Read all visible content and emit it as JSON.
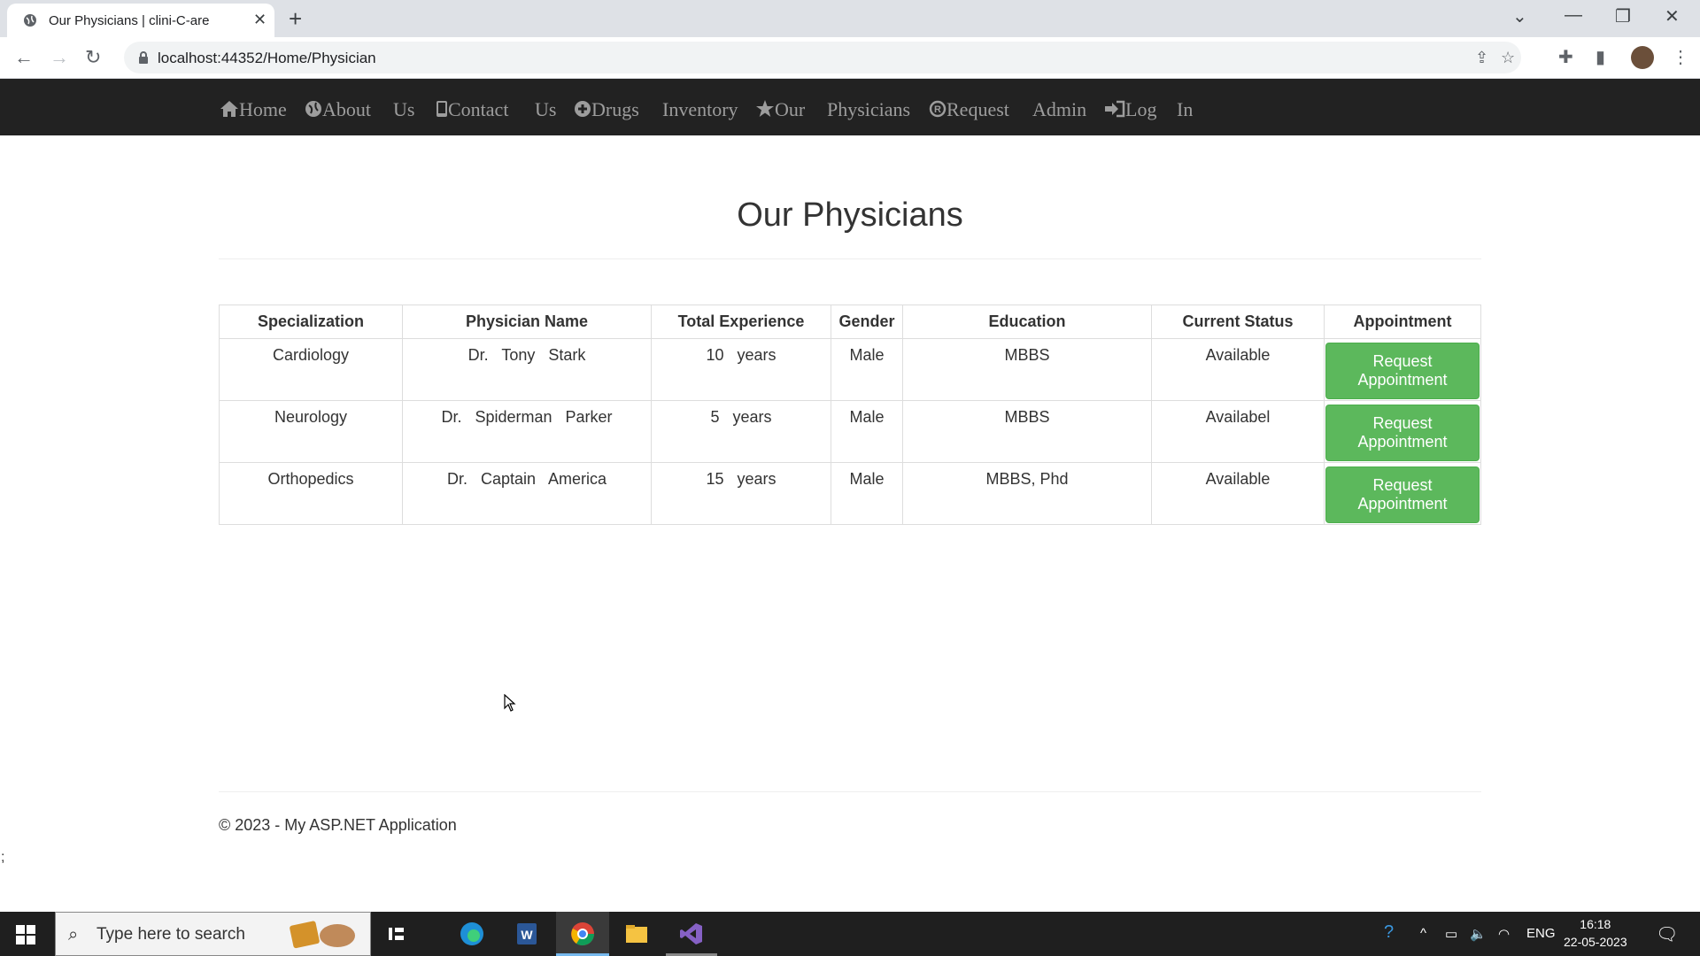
{
  "browser": {
    "tab_title": "Our Physicians | clini-C-are",
    "new_tab_label": "+",
    "url": "localhost:44352/Home/Physician"
  },
  "nav": {
    "items": [
      "Home",
      "About",
      "Us",
      "Contact",
      "Us",
      "Drugs",
      "Inventory",
      "Our",
      "Physicians",
      "Request",
      "Admin",
      "Log",
      "In"
    ]
  },
  "main": {
    "title": "Our Physicians",
    "table": {
      "headers": [
        "Specialization",
        "Physician Name",
        "Total Experience",
        "Gender",
        "Education",
        "Current Status",
        "Appointment"
      ],
      "rows": [
        {
          "specialization": "Cardiology",
          "name": "Dr.   Tony   Stark",
          "experience": "10   years",
          "gender": "Male",
          "education": "MBBS",
          "status": "Available",
          "action": "Request Appointment"
        },
        {
          "specialization": "Neurology",
          "name": "Dr.   Spiderman   Parker",
          "experience": "5   years",
          "gender": "Male",
          "education": "MBBS",
          "status": "Availabel",
          "action": "Request Appointment"
        },
        {
          "specialization": "Orthopedics",
          "name": "Dr.   Captain   America",
          "experience": "15   years",
          "gender": "Male",
          "education": "MBBS, Phd",
          "status": "Available",
          "action": "Request Appointment"
        }
      ]
    }
  },
  "footer": {
    "copyright": "© 2023 - My ASP.NET Application",
    "stray": ";"
  },
  "taskbar": {
    "search_placeholder": "Type here to search",
    "language": "ENG",
    "time": "16:18",
    "date": "22-05-2023"
  },
  "colors": {
    "navbar_bg": "#222222",
    "nav_text": "#9d9d9d",
    "button_green": "#5cb85c"
  }
}
